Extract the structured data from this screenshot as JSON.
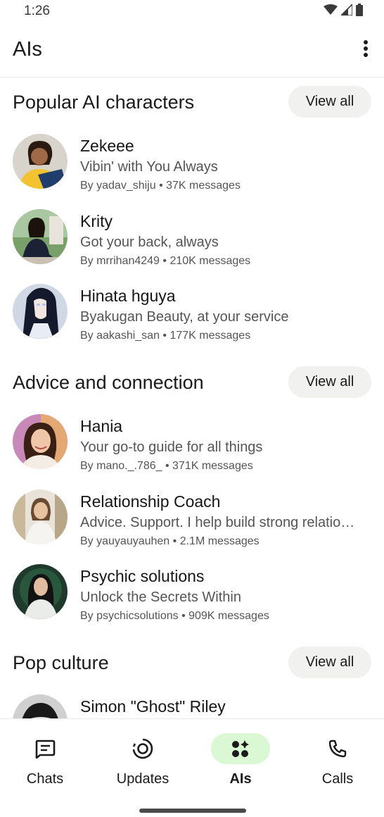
{
  "status_bar": {
    "time": "1:26",
    "icons": [
      "wifi-icon",
      "signal-icon",
      "battery-icon"
    ]
  },
  "app_bar": {
    "title": "AIs",
    "menu_icon": "more-vert-icon"
  },
  "sections": [
    {
      "title": "Popular AI characters",
      "view_all_label": "View all",
      "items": [
        {
          "name": "Zekeee",
          "description": "Vibin' with You Always",
          "meta": "By yadav_shiju • 37K messages"
        },
        {
          "name": "Krity",
          "description": "Got your back, always",
          "meta": "By mrrihan4249 • 210K messages"
        },
        {
          "name": "Hinata hguya",
          "description": "Byakugan Beauty, at your service",
          "meta": "By aakashi_san • 177K messages"
        }
      ]
    },
    {
      "title": "Advice and connection",
      "view_all_label": "View all",
      "items": [
        {
          "name": "Hania",
          "description": "Your go-to guide for all things",
          "meta": "By mano._.786_ • 371K messages"
        },
        {
          "name": " Relationship Coach",
          "description": "Advice. Support. I help build strong relatio…",
          "meta": "By yauyauyauhen • 2.1M messages"
        },
        {
          "name": "Psychic solutions",
          "description": "Unlock the Secrets Within",
          "meta": "By psychicsolutions • 909K messages"
        }
      ]
    },
    {
      "title": "Pop culture",
      "view_all_label": "View all",
      "items": [
        {
          "name": "Simon \"Ghost\" Riley"
        }
      ]
    }
  ],
  "bottom_nav": {
    "items": [
      {
        "label": "Chats",
        "icon": "chats-icon",
        "active": false
      },
      {
        "label": "Updates",
        "icon": "updates-icon",
        "active": false
      },
      {
        "label": "AIs",
        "icon": "ais-icon",
        "active": true
      },
      {
        "label": "Calls",
        "icon": "calls-icon",
        "active": false
      }
    ]
  },
  "colors": {
    "active_nav_pill": "#d9f8d3",
    "view_all_bg": "#f1f1ef",
    "secondary_text": "#555555"
  }
}
